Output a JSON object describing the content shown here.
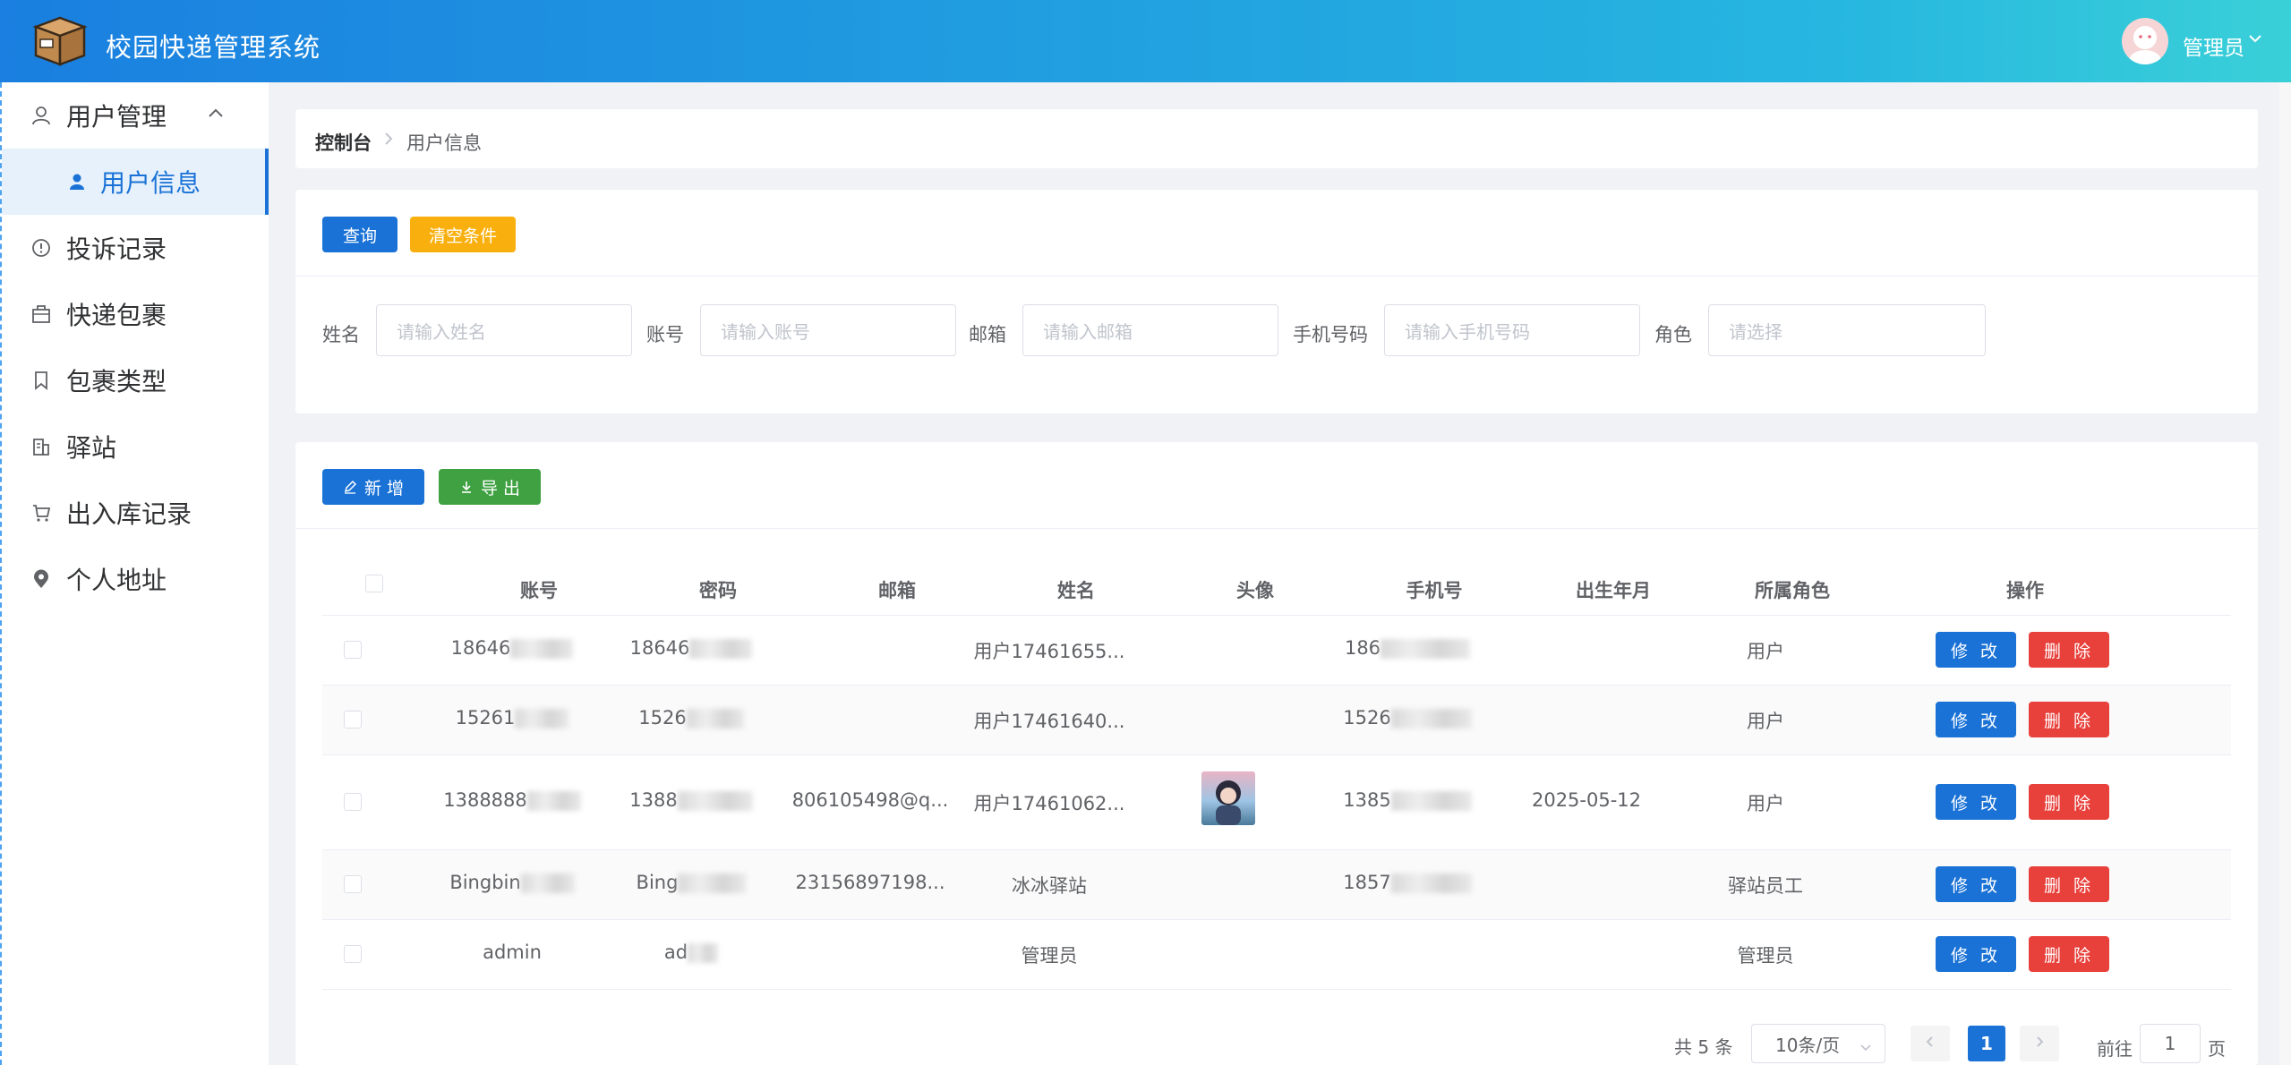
{
  "header": {
    "app_title": "校园快递管理系统",
    "user_name": "管理员"
  },
  "sidebar": {
    "items": [
      {
        "label": "用户管理",
        "icon": "user-icon"
      },
      {
        "label": "用户信息",
        "icon": "person-icon"
      },
      {
        "label": "投诉记录",
        "icon": "alert-circle-icon"
      },
      {
        "label": "快递包裹",
        "icon": "package-icon"
      },
      {
        "label": "包裹类型",
        "icon": "bookmark-icon"
      },
      {
        "label": "驿站",
        "icon": "building-icon"
      },
      {
        "label": "出入库记录",
        "icon": "cart-icon"
      },
      {
        "label": "个人地址",
        "icon": "location-pin-icon"
      }
    ]
  },
  "breadcrumb": {
    "root": "控制台",
    "current": "用户信息"
  },
  "filter": {
    "query_label": "查询",
    "clear_label": "清空条件",
    "fields": [
      {
        "label": "姓名",
        "placeholder": "请输入姓名"
      },
      {
        "label": "账号",
        "placeholder": "请输入账号"
      },
      {
        "label": "邮箱",
        "placeholder": "请输入邮箱"
      },
      {
        "label": "手机号码",
        "placeholder": "请输入手机号码"
      },
      {
        "label": "角色",
        "placeholder": "请选择"
      }
    ]
  },
  "toolbar": {
    "add_label": "新 增",
    "export_label": "导 出"
  },
  "table": {
    "columns": [
      "账号",
      "密码",
      "邮箱",
      "姓名",
      "头像",
      "手机号",
      "出生年月",
      "所属角色",
      "操作"
    ],
    "edit_label": "修 改",
    "delete_label": "删 除",
    "rows": [
      {
        "account": "18646",
        "password": "18646",
        "email": "",
        "name": "用户17461655...",
        "phone": "186",
        "birth": "",
        "role": "用户"
      },
      {
        "account": "15261",
        "password": "1526",
        "email": "",
        "name": "用户17461640...",
        "phone": "1526",
        "birth": "",
        "role": "用户"
      },
      {
        "account": "1388888",
        "password": "1388",
        "email": "806105498@q...",
        "name": "用户17461062...",
        "phone": "1385",
        "birth": "2025-05-12",
        "role": "用户"
      },
      {
        "account": "Bingbin",
        "password": "Bing",
        "email": "23156897198...",
        "name": "冰冰驿站",
        "phone": "1857",
        "birth": "",
        "role": "驿站员工"
      },
      {
        "account": "admin",
        "password": "ad",
        "email": "",
        "name": "管理员",
        "phone": "",
        "birth": "",
        "role": "管理员"
      }
    ]
  },
  "pagination": {
    "total_text": "共 5 条",
    "page_size": "10条/页",
    "current_page": "1",
    "goto_prefix": "前往",
    "goto_value": "1",
    "goto_suffix": "页"
  },
  "colors": {
    "primary": "#1a72d6",
    "warning": "#f9b00e",
    "success": "#3fa142",
    "danger": "#e8403b"
  }
}
